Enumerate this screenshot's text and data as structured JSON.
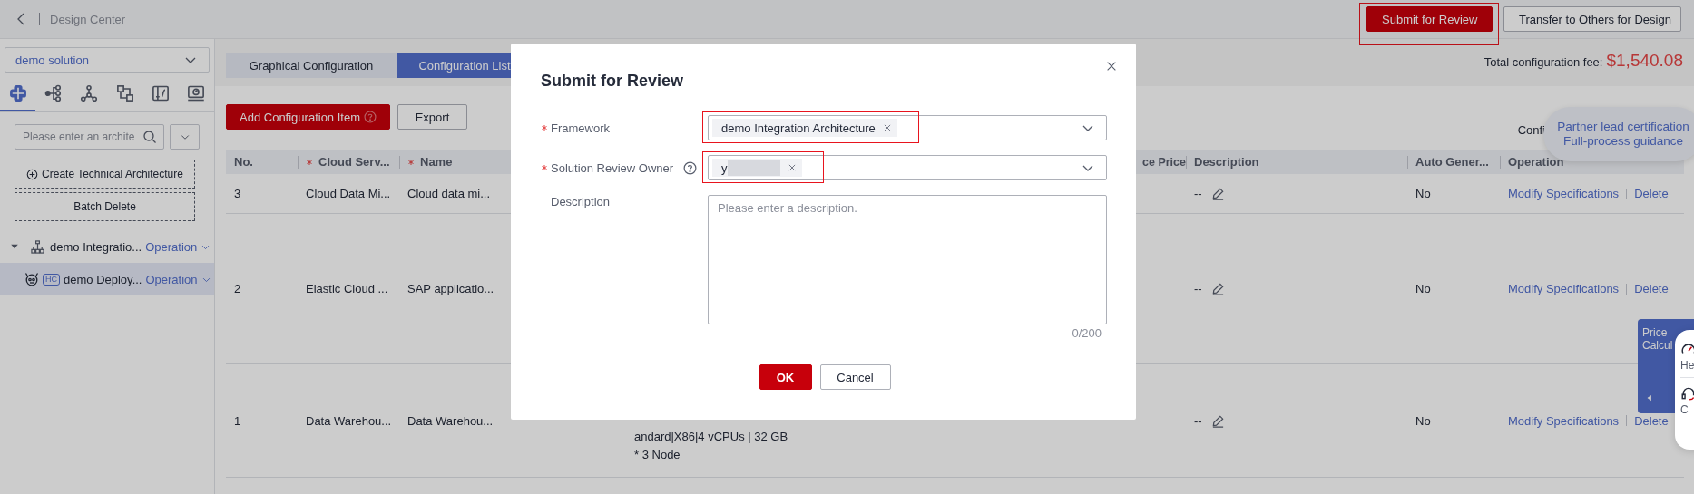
{
  "header": {
    "title": "Design Center",
    "buttons": [
      {
        "label": "Submit for Review",
        "kind": "primary",
        "highlighted": true
      },
      {
        "label": "Transfer to Others for Design",
        "kind": "default",
        "highlighted": false
      }
    ]
  },
  "sidebar": {
    "solution": "demo solution",
    "icon_tabs": [
      {
        "selected": true
      },
      {
        "selected": false
      },
      {
        "selected": false
      },
      {
        "selected": false
      },
      {
        "selected": false
      },
      {
        "selected": false
      }
    ],
    "search": {
      "placeholder": "Please enter an archite"
    },
    "actions": [
      "Create Technical Architecture",
      "Batch Delete"
    ],
    "tree": [
      {
        "label": "demo Integratio...",
        "action": "Operation",
        "expanded": true,
        "selected": false,
        "children": [
          {
            "label": "demo Deploy...",
            "badge": "HC",
            "action": "Operation",
            "selected": true
          }
        ]
      }
    ]
  },
  "tabs": [
    {
      "label": "Graphical Configuration",
      "selected": false
    },
    {
      "label": "Configuration List",
      "selected": true
    }
  ],
  "total_fee": {
    "label": "Total configuration fee:",
    "amount": "$1,540.08"
  },
  "toolbar": {
    "buttons": [
      {
        "label": "Add Configuration Item",
        "kind": "primary",
        "help": true
      },
      {
        "label": "Export",
        "kind": "default",
        "help": false
      }
    ],
    "note": "Confi"
  },
  "table": {
    "columns": [
      {
        "label": "No.",
        "required": false
      },
      {
        "label": "Cloud Serv...",
        "required": true
      },
      {
        "label": "Name",
        "required": true
      },
      {
        "label": "ce Price",
        "required": false
      },
      {
        "label": "Description",
        "required": false
      },
      {
        "label": "Auto Gener...",
        "required": false
      },
      {
        "label": "Operation",
        "required": false
      }
    ],
    "rows": [
      {
        "no": "3",
        "service": "Cloud Data Mi...",
        "name": "Cloud data mi...",
        "description": "--",
        "auto_generated": "No",
        "actions": [
          "Modify Specifications",
          "Delete"
        ]
      },
      {
        "no": "2",
        "service": "Elastic Cloud ...",
        "name": "SAP applicatio...",
        "description": "--",
        "auto_generated": "No",
        "actions": [
          "Modify Specifications",
          "Delete"
        ]
      },
      {
        "no": "1",
        "service": "Data Warehou...",
        "name": "Data Warehou...",
        "spec": [
          "andard|X86|4 vCPUs | 32 GB",
          "* 3 Node"
        ],
        "description": "--",
        "auto_generated": "No",
        "actions": [
          "Modify Specifications",
          "Delete"
        ]
      }
    ]
  },
  "dialog": {
    "title": "Submit for Review",
    "fields": [
      {
        "label": "Framework",
        "required": true,
        "help": false,
        "kind": "select",
        "highlighted": true,
        "tags": [
          {
            "text": "demo Integration Architecture",
            "redacted": false
          }
        ]
      },
      {
        "label": "Solution Review Owner",
        "required": true,
        "help": true,
        "kind": "select",
        "highlighted": true,
        "tags": [
          {
            "text": "y",
            "redacted": true
          }
        ]
      },
      {
        "label": "Description",
        "required": false,
        "help": false,
        "kind": "textarea",
        "placeholder": "Please enter a description.",
        "counter": "0/200"
      }
    ],
    "buttons": [
      {
        "label": "OK",
        "kind": "primary"
      },
      {
        "label": "Cancel",
        "kind": "default"
      }
    ]
  },
  "guide_bubble": [
    "Partner lead certification",
    "Full-process guidance"
  ],
  "price_panel": {
    "label": "Price Calcul"
  },
  "help_widget": {
    "items": [
      "He",
      "C"
    ]
  }
}
